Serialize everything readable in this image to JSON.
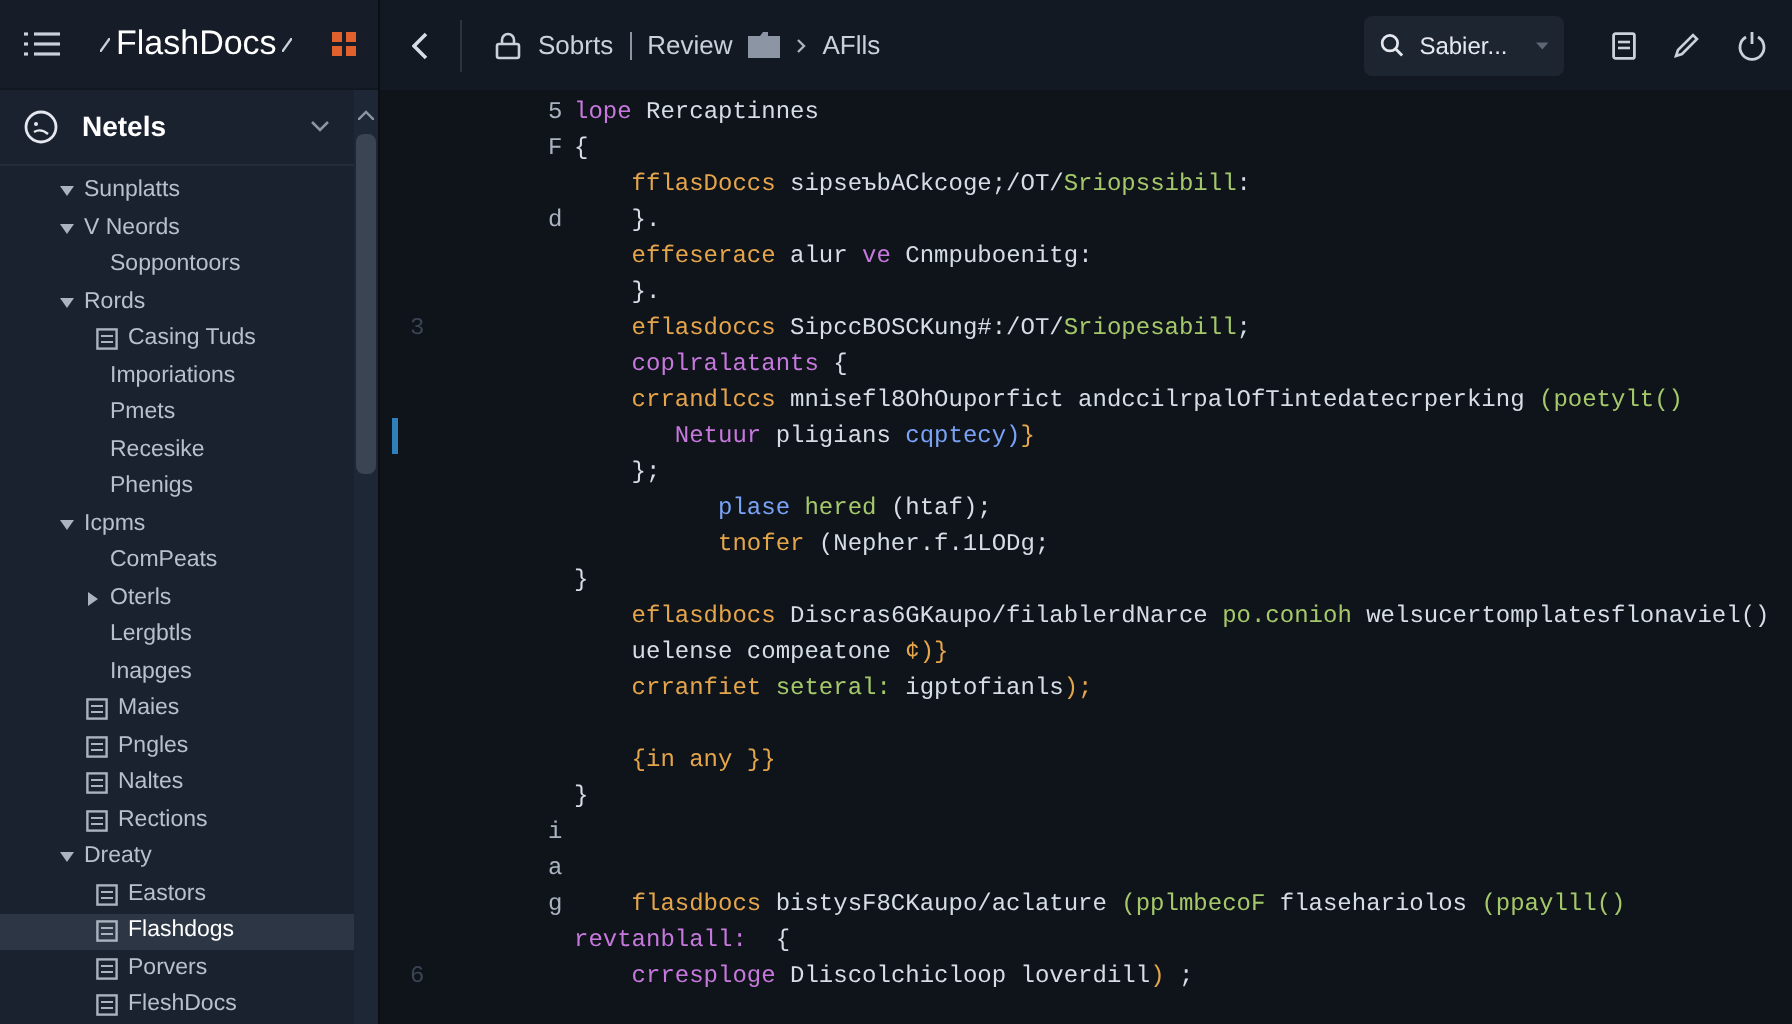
{
  "sidebar": {
    "brand": "FlashDocs",
    "section": {
      "label": "Netels",
      "expanded": true
    },
    "tree": [
      {
        "label": "Sunplatts",
        "kind": "node",
        "expanded": true,
        "selected": false
      },
      {
        "label": "V Neords",
        "kind": "node",
        "expanded": true,
        "selected": false,
        "children": [
          {
            "label": "Soppontoors",
            "kind": "leaf",
            "selected": false
          }
        ]
      },
      {
        "label": "Rords",
        "kind": "node",
        "expanded": true,
        "selected": false,
        "children": [
          {
            "label": "Casing Tuds",
            "kind": "file",
            "selected": false
          },
          {
            "label": "Imporiations",
            "kind": "leaf",
            "selected": false
          },
          {
            "label": "Pmets",
            "kind": "leaf",
            "selected": false
          },
          {
            "label": "Recesike",
            "kind": "leaf",
            "selected": false
          },
          {
            "label": "Phenigs",
            "kind": "leaf",
            "selected": false
          }
        ]
      },
      {
        "label": "Icpms",
        "kind": "node",
        "expanded": true,
        "selected": false,
        "children": [
          {
            "label": "ComPeats",
            "kind": "leaf",
            "selected": false
          },
          {
            "label": "Oterls",
            "kind": "node",
            "expanded": false,
            "selected": false
          },
          {
            "label": "Lergbtls",
            "kind": "leaf",
            "selected": false
          },
          {
            "label": "Inapges",
            "kind": "leaf",
            "selected": false
          }
        ]
      },
      {
        "label": "Maies",
        "kind": "file",
        "selected": false
      },
      {
        "label": "Pngles",
        "kind": "file",
        "selected": false
      },
      {
        "label": "Naltes",
        "kind": "file",
        "selected": false
      },
      {
        "label": "Rections",
        "kind": "file",
        "selected": false
      },
      {
        "label": "Dreaty",
        "kind": "node",
        "expanded": true,
        "selected": false,
        "children": [
          {
            "label": "Eastors",
            "kind": "file",
            "selected": false
          },
          {
            "label": "Flashdogs",
            "kind": "file",
            "selected": true
          },
          {
            "label": "Porvers",
            "kind": "file",
            "selected": false
          },
          {
            "label": "FleshDocs",
            "kind": "file",
            "selected": false
          }
        ]
      }
    ]
  },
  "toolbar": {
    "breadcrumb": [
      "Sobrts",
      "Review",
      "AFlls"
    ],
    "search": {
      "placeholder": "Sabier..."
    }
  },
  "code": [
    {
      "mark": "5",
      "changed": false,
      "tokens": [
        {
          "text": "lope",
          "kind": "keyword"
        },
        {
          "text": " Rercaptinnes",
          "kind": "plain"
        }
      ]
    },
    {
      "mark": "F",
      "changed": false,
      "tokens": [
        {
          "text": "{",
          "kind": "plain"
        }
      ]
    },
    {
      "changed": false,
      "tokens": [
        {
          "text": "    fflasDoccs",
          "kind": "name"
        },
        {
          "text": " sipseъbACkcoge;/OT/",
          "kind": "plain"
        },
        {
          "text": "Sriopssibill",
          "kind": "string"
        },
        {
          "text": ":",
          "kind": "plain"
        }
      ]
    },
    {
      "mark": "d",
      "changed": false,
      "tokens": [
        {
          "text": "    }.",
          "kind": "plain"
        }
      ]
    },
    {
      "changed": false,
      "tokens": [
        {
          "text": "    effeserace",
          "kind": "name"
        },
        {
          "text": " alur ",
          "kind": "plain"
        },
        {
          "text": "ve",
          "kind": "keyword"
        },
        {
          "text": " Cnmpuboenitg:",
          "kind": "plain"
        }
      ]
    },
    {
      "changed": false,
      "tokens": [
        {
          "text": "    }.",
          "kind": "plain"
        }
      ]
    },
    {
      "number": "3",
      "changed": false,
      "tokens": [
        {
          "text": "    eflasdoccs",
          "kind": "name"
        },
        {
          "text": " SipccBOSCKung#:/OT/",
          "kind": "plain"
        },
        {
          "text": "Sriopesabill",
          "kind": "string"
        },
        {
          "text": ";",
          "kind": "plain"
        }
      ]
    },
    {
      "changed": false,
      "tokens": [
        {
          "text": "    coplralatants",
          "kind": "keyword"
        },
        {
          "text": " {",
          "kind": "plain"
        }
      ]
    },
    {
      "changed": false,
      "tokens": [
        {
          "text": "    crrandlccs",
          "kind": "name"
        },
        {
          "text": " mnisefl8OhOuporfict andccilrpalOfTintedatecrperking ",
          "kind": "plain"
        },
        {
          "text": "(poetylt()",
          "kind": "string"
        }
      ]
    },
    {
      "changed": true,
      "tokens": [
        {
          "text": "       Netuur",
          "kind": "keyword"
        },
        {
          "text": " pligians ",
          "kind": "plain"
        },
        {
          "text": "cqptecy)",
          "kind": "call"
        },
        {
          "text": "}",
          "kind": "name"
        }
      ]
    },
    {
      "changed": false,
      "tokens": [
        {
          "text": "    };",
          "kind": "plain"
        }
      ]
    },
    {
      "changed": false,
      "tokens": [
        {
          "text": "          plase",
          "kind": "call"
        },
        {
          "text": " hered",
          "kind": "string"
        },
        {
          "text": " (htaf);",
          "kind": "plain"
        }
      ]
    },
    {
      "changed": false,
      "tokens": [
        {
          "text": "          tnofer",
          "kind": "name"
        },
        {
          "text": " (Nepher.f.1LODg;",
          "kind": "plain"
        }
      ]
    },
    {
      "changed": false,
      "tokens": [
        {
          "text": "}",
          "kind": "plain"
        }
      ]
    },
    {
      "changed": false,
      "tokens": [
        {
          "text": "    eflasdbocs",
          "kind": "name"
        },
        {
          "text": " Discras6GKaupo/filablerdNarce ",
          "kind": "plain"
        },
        {
          "text": "po.conioh",
          "kind": "string"
        },
        {
          "text": " welsucertomplatesflonaviel()",
          "kind": "plain"
        }
      ]
    },
    {
      "changed": false,
      "tokens": [
        {
          "text": "    uelense compeatone ",
          "kind": "plain"
        },
        {
          "text": "¢)}",
          "kind": "name"
        }
      ]
    },
    {
      "changed": false,
      "tokens": [
        {
          "text": "    crranfiet",
          "kind": "name"
        },
        {
          "text": " seteral:",
          "kind": "string"
        },
        {
          "text": " igptofianls",
          "kind": "plain"
        },
        {
          "text": ");",
          "kind": "name"
        }
      ]
    },
    {
      "changed": false
    },
    {
      "changed": false,
      "tokens": [
        {
          "text": "    {in any }}",
          "kind": "name"
        }
      ]
    },
    {
      "changed": false,
      "tokens": [
        {
          "text": "}",
          "kind": "plain"
        }
      ]
    },
    {
      "mark": "i",
      "changed": false
    },
    {
      "mark": "a",
      "changed": false
    },
    {
      "mark": "g",
      "changed": false,
      "tokens": [
        {
          "text": "    flasdbocs",
          "kind": "name"
        },
        {
          "text": " bistysF8CKaupo/aclature ",
          "kind": "plain"
        },
        {
          "text": "(pplmbecoF",
          "kind": "string"
        },
        {
          "text": " flasehariolos ",
          "kind": "plain"
        },
        {
          "text": "(ppaylll()",
          "kind": "string"
        }
      ]
    },
    {
      "changed": false,
      "tokens": [
        {
          "text": "revtanblall:",
          "kind": "keyword"
        },
        {
          "text": "  {",
          "kind": "plain"
        }
      ]
    },
    {
      "number": "6",
      "changed": false,
      "tokens": [
        {
          "text": "    crresploge",
          "kind": "keyword"
        },
        {
          "text": " Dliscolchicloop loverdill",
          "kind": "plain"
        },
        {
          "text": ")",
          "kind": "name"
        },
        {
          "text": " ;",
          "kind": "plain"
        }
      ]
    }
  ]
}
